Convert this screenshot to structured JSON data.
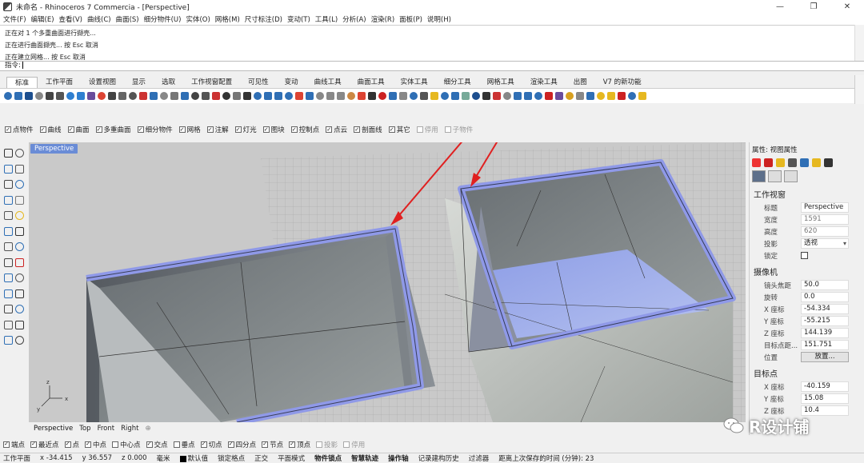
{
  "window": {
    "title": "未命名 - Rhinoceros 7 Commercia - [Perspective]",
    "controls": {
      "minimize": "—",
      "maximize": "❐",
      "close": "✕"
    }
  },
  "menu": [
    "文件(F)",
    "编辑(E)",
    "查看(V)",
    "曲线(C)",
    "曲面(S)",
    "细分物件(U)",
    "实体(O)",
    "网格(M)",
    "尺寸标注(D)",
    "变动(T)",
    "工具(L)",
    "分析(A)",
    "渲染(R)",
    "面板(P)",
    "说明(H)"
  ],
  "command_history": [
    "正在对 1 个多重曲面进行撷壳...",
    "正在进行曲面撷壳... 按 Esc 取消",
    "正在建立网格... 按 Esc 取消"
  ],
  "command_prompt": "指令:",
  "tabs": [
    "标准",
    "工作平面",
    "设置视图",
    "显示",
    "选取",
    "工作视窗配置",
    "可见性",
    "变动",
    "曲线工具",
    "曲面工具",
    "实体工具",
    "细分工具",
    "网格工具",
    "渲染工具",
    "出图",
    "V7 的新功能"
  ],
  "active_tab_index": 0,
  "toolbar_colors": [
    "#2f6fb5",
    "#2f6fb5",
    "#1d4f8f",
    "#888",
    "#444",
    "#555",
    "#2f7fd0",
    "#2f7fd0",
    "#6a4c9c",
    "#d43",
    "#444",
    "#666",
    "#555",
    "#c33",
    "#2f6fb5",
    "#888",
    "#777",
    "#2f6fb5",
    "#444",
    "#555",
    "#c33",
    "#333",
    "#777",
    "#333",
    "#2f6fb5",
    "#2f6fb5",
    "#2f6fb5",
    "#2f6fb5",
    "#d43",
    "#2f6fb5",
    "#888",
    "#888",
    "#888",
    "#c84",
    "#d43",
    "#333",
    "#c22",
    "#2f6fb5",
    "#888",
    "#2f6fb5",
    "#555",
    "#e6b820",
    "#2f6fb5",
    "#2f6fb5",
    "#7a9",
    "#1d4f8f",
    "#333",
    "#c33",
    "#888",
    "#2f6fb5",
    "#2f6fb5",
    "#2f6fb5",
    "#c22",
    "#6a4c9c",
    "#d8a020",
    "#888",
    "#2f6fb5",
    "#e6b820",
    "#e6b820",
    "#c22",
    "#2f6fb5",
    "#e6b820"
  ],
  "object_filters": [
    {
      "label": "点物件",
      "checked": true
    },
    {
      "label": "曲线",
      "checked": true
    },
    {
      "label": "曲面",
      "checked": true
    },
    {
      "label": "多重曲面",
      "checked": true
    },
    {
      "label": "细分物件",
      "checked": true
    },
    {
      "label": "网格",
      "checked": true
    },
    {
      "label": "注解",
      "checked": true
    },
    {
      "label": "灯光",
      "checked": true
    },
    {
      "label": "图块",
      "checked": true
    },
    {
      "label": "控制点",
      "checked": true
    },
    {
      "label": "点云",
      "checked": true
    },
    {
      "label": "剖面线",
      "checked": true
    },
    {
      "label": "其它",
      "checked": true
    },
    {
      "label": "停用",
      "checked": false,
      "disabled": true
    },
    {
      "label": "子物件",
      "checked": false,
      "disabled": true
    }
  ],
  "viewport": {
    "label": "Perspective",
    "tabs": [
      "Perspective",
      "Top",
      "Front",
      "Right"
    ],
    "add_tab": "⊕",
    "axes": {
      "x": "x",
      "y": "y",
      "z": "z"
    }
  },
  "properties": {
    "header": "属性: 视图属性",
    "icon_colors": [
      "#e33",
      "#c22",
      "#e6b820",
      "#555",
      "#2f6fb5",
      "#e6b820",
      "#333"
    ],
    "section_viewport": "工作视窗",
    "title_label": "标题",
    "title_value": "Perspective",
    "width_label": "宽度",
    "width_value": "1591",
    "height_label": "高度",
    "height_value": "620",
    "projection_label": "投影",
    "projection_value": "透视",
    "locked_label": "锁定",
    "section_camera": "摄像机",
    "lens_label": "镜头焦距",
    "lens_value": "50.0",
    "rotation_label": "旋转",
    "rotation_value": "0.0",
    "cx_label": "X 座标",
    "cx_value": "-54.334",
    "cy_label": "Y 座标",
    "cy_value": "-55.215",
    "cz_label": "Z 座标",
    "cz_value": "144.139",
    "dist_label": "目标点距...",
    "dist_value": "151.751",
    "pos_label": "位置",
    "pos_button": "放置...",
    "section_target": "目标点",
    "tx_label": "X 座标",
    "tx_value": "-40.159",
    "ty_label": "Y 座标",
    "ty_value": "15.08",
    "tz_label": "Z 座标",
    "tz_value": "10.4"
  },
  "snaps": [
    {
      "label": "端点",
      "checked": true
    },
    {
      "label": "最近点",
      "checked": true
    },
    {
      "label": "点",
      "checked": true
    },
    {
      "label": "中点",
      "checked": true
    },
    {
      "label": "中心点",
      "checked": false
    },
    {
      "label": "交点",
      "checked": true
    },
    {
      "label": "垂点",
      "checked": false
    },
    {
      "label": "切点",
      "checked": true
    },
    {
      "label": "四分点",
      "checked": true
    },
    {
      "label": "节点",
      "checked": true
    },
    {
      "label": "顶点",
      "checked": true
    },
    {
      "label": "投影",
      "checked": false,
      "disabled": true
    },
    {
      "label": "停用",
      "checked": false,
      "disabled": true
    }
  ],
  "status": {
    "cplane": "工作平面",
    "x": "x -34.415",
    "y": "y 36.557",
    "z": "z 0.000",
    "units": "毫米",
    "layer": "默认值",
    "grid_snap": "锁定格点",
    "ortho": "正交",
    "planar": "平面模式",
    "osnap": "物件锁点",
    "smarttrack": "智慧轨迹",
    "gumball": "操作轴",
    "history": "记录建构历史",
    "filter": "过滤器",
    "autosave": "距离上次保存的时间 (分钟): 23"
  },
  "watermark": "R设计铺"
}
